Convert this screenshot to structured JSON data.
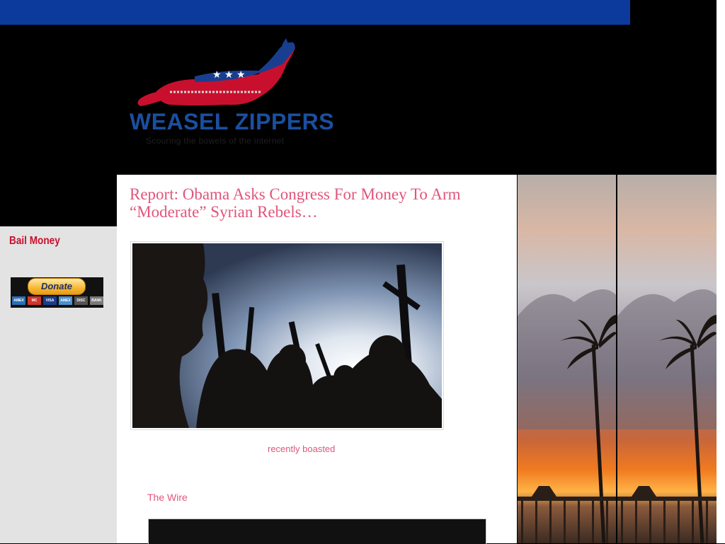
{
  "header": {
    "brand_name": "WEASEL ZIPPERS",
    "tagline": "Scouring the bowels of the internet"
  },
  "sidebar": {
    "title": "Bail Money",
    "donate_label": "Donate",
    "cards": [
      {
        "label": "AMEX",
        "color": "#2a6fb5"
      },
      {
        "label": "MC",
        "color": "#d0342c"
      },
      {
        "label": "VISA",
        "color": "#1a3e8f"
      },
      {
        "label": "AMEX",
        "color": "#4a8fd1"
      },
      {
        "label": "DISC",
        "color": "#555555"
      },
      {
        "label": "BANK",
        "color": "#7a7a7a"
      }
    ]
  },
  "post": {
    "title": "Report: Obama Asks Congress For Money To Arm “Moderate” Syrian Rebels…",
    "recent_label": "recently boasted",
    "wire_label": "The Wire"
  },
  "colors": {
    "accent_pink": "#e0557c",
    "topbar_blue": "#0b3a9c",
    "brand_blue": "#1a4fa0",
    "brand_red": "#c8102e"
  }
}
